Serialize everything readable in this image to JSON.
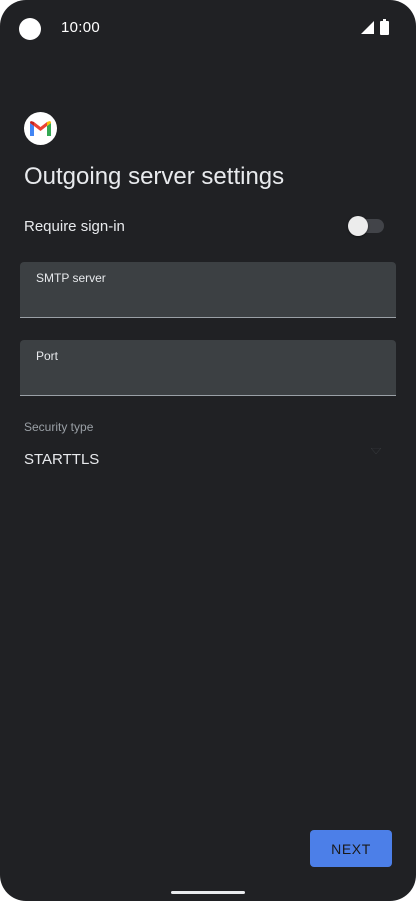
{
  "status_bar": {
    "time": "10:00",
    "icons": [
      "camera-cutout",
      "signal-icon",
      "battery-icon"
    ]
  },
  "app": {
    "logo": "gmail-logo",
    "title": "Outgoing server settings"
  },
  "require_signin": {
    "label": "Require sign-in",
    "enabled": false
  },
  "smtp_server": {
    "label": "SMTP server",
    "value": "",
    "placeholder": ""
  },
  "port": {
    "label": "Port",
    "value": "",
    "placeholder": ""
  },
  "security_type": {
    "label": "Security type",
    "value": "STARTTLS",
    "icon": "dropdown-arrow-icon"
  },
  "actions": {
    "next_label": "NEXT"
  },
  "colors": {
    "background": "#202124",
    "field_background": "#3c4043",
    "primary_button": "#4c7fe8",
    "text_primary": "#e8eaed",
    "text_secondary": "#9aa0a6"
  }
}
